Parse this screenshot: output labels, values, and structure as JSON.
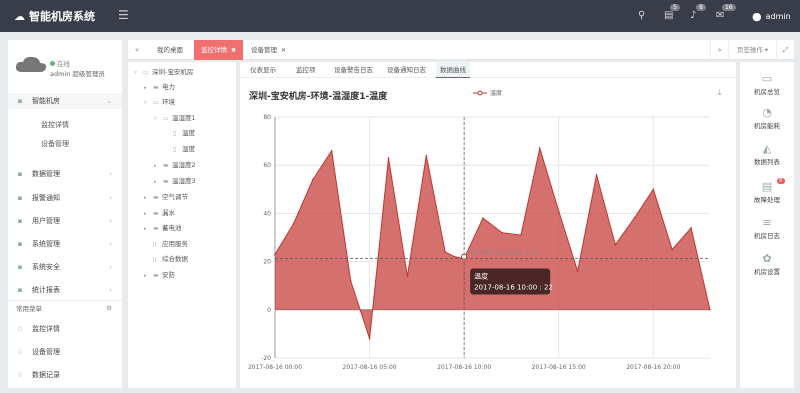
{
  "app": {
    "title": "智能机房系统",
    "user": "admin"
  },
  "badges": {
    "messages": "5",
    "alerts": "8",
    "mail": "16"
  },
  "sidebar": {
    "status": "在线",
    "user_line": "admin 超级管理员",
    "items": [
      {
        "label": "智能机房",
        "icon": "monitor-icon"
      },
      {
        "label": "监控详情"
      },
      {
        "label": "设备管理"
      },
      {
        "label": "数据管理",
        "icon": "chart-icon"
      },
      {
        "label": "报警通知",
        "icon": "bell-icon"
      },
      {
        "label": "用户管理",
        "icon": "users-icon"
      },
      {
        "label": "系统管理",
        "icon": "gear-icon"
      },
      {
        "label": "系统安全",
        "icon": "shield-icon"
      },
      {
        "label": "统计报表",
        "icon": "stats-icon"
      }
    ],
    "common_title": "常用菜单",
    "common": [
      {
        "label": "监控详情"
      },
      {
        "label": "设备管理"
      },
      {
        "label": "数据记录"
      }
    ]
  },
  "tabs": [
    {
      "label": "我的桌面"
    },
    {
      "label": "监控详情"
    },
    {
      "label": "设备管理"
    }
  ],
  "page_ops": "页签操作",
  "tree": [
    {
      "label": "深圳-宝安机房"
    },
    {
      "label": "电力"
    },
    {
      "label": "环境"
    },
    {
      "label": "温湿度1"
    },
    {
      "label": "温度"
    },
    {
      "label": "湿度"
    },
    {
      "label": "温湿度2"
    },
    {
      "label": "温湿度3"
    },
    {
      "label": "空气调节"
    },
    {
      "label": "漏水"
    },
    {
      "label": "蓄电池"
    },
    {
      "label": "应用服务"
    },
    {
      "label": "综合数据"
    },
    {
      "label": "安防"
    }
  ],
  "subtabs": [
    {
      "label": "仪表显示"
    },
    {
      "label": "监控项"
    },
    {
      "label": "设备警告日志"
    },
    {
      "label": "设备通知日志"
    },
    {
      "label": "数据曲线"
    }
  ],
  "rightbar": [
    {
      "label": "机房总览",
      "icon": "screen-icon"
    },
    {
      "label": "机房能耗",
      "icon": "pie-icon"
    },
    {
      "label": "数据列表",
      "icon": "area-icon"
    },
    {
      "label": "故障处理",
      "icon": "server-icon",
      "badge": "8"
    },
    {
      "label": "机房日志",
      "icon": "database-icon"
    },
    {
      "label": "机房设置",
      "icon": "cogs-icon"
    }
  ],
  "chart_data": {
    "type": "area",
    "title": "深圳-宝安机房-环境-温湿度1-温度",
    "series": [
      {
        "name": "温度",
        "color": "#c23531",
        "values": [
          23,
          36,
          54,
          66,
          12,
          -12,
          63,
          14,
          64,
          24,
          22,
          21.3,
          38,
          32,
          31,
          67,
          41,
          16,
          56,
          27,
          38,
          50,
          25,
          34,
          0
        ]
      }
    ],
    "x": [
      "2017-08-16 00:00",
      "2017-08-16 01:00",
      "2017-08-16 02:00",
      "2017-08-16 03:00",
      "2017-08-16 04:00",
      "2017-08-16 05:00",
      "2017-08-16 06:00",
      "2017-08-16 07:00",
      "2017-08-16 08:00",
      "2017-08-16 09:00",
      "2017-08-16 09:30",
      "2017-08-16 10:00",
      "2017-08-16 11:00",
      "2017-08-16 12:00",
      "2017-08-16 13:00",
      "2017-08-16 14:00",
      "2017-08-16 15:00",
      "2017-08-16 16:00",
      "2017-08-16 17:00",
      "2017-08-16 18:00",
      "2017-08-16 19:00",
      "2017-08-16 20:00",
      "2017-08-16 21:00",
      "2017-08-16 22:00",
      "2017-08-16 23:00"
    ],
    "x_hours": [
      0,
      1,
      2,
      3,
      4,
      5,
      6,
      7,
      8,
      9,
      9.5,
      10,
      11,
      12,
      13,
      14,
      15,
      16,
      17,
      18,
      19,
      20,
      21,
      22,
      23
    ],
    "xticks": [
      "2017-08-16 00:00",
      "2017-08-16 05:00",
      "2017-08-16 10:00",
      "2017-08-16 15:00",
      "2017-08-16 20:00"
    ],
    "yticks": [
      "-20",
      "0",
      "20",
      "40",
      "60",
      "80"
    ],
    "ylim": [
      -20,
      80
    ],
    "xlim_hours": [
      0,
      23
    ],
    "crosshair_label": "2017-08-16 10:00, 21.3",
    "tooltip": {
      "name": "温度",
      "value": "2017-08-16 10:00 : 22"
    }
  }
}
